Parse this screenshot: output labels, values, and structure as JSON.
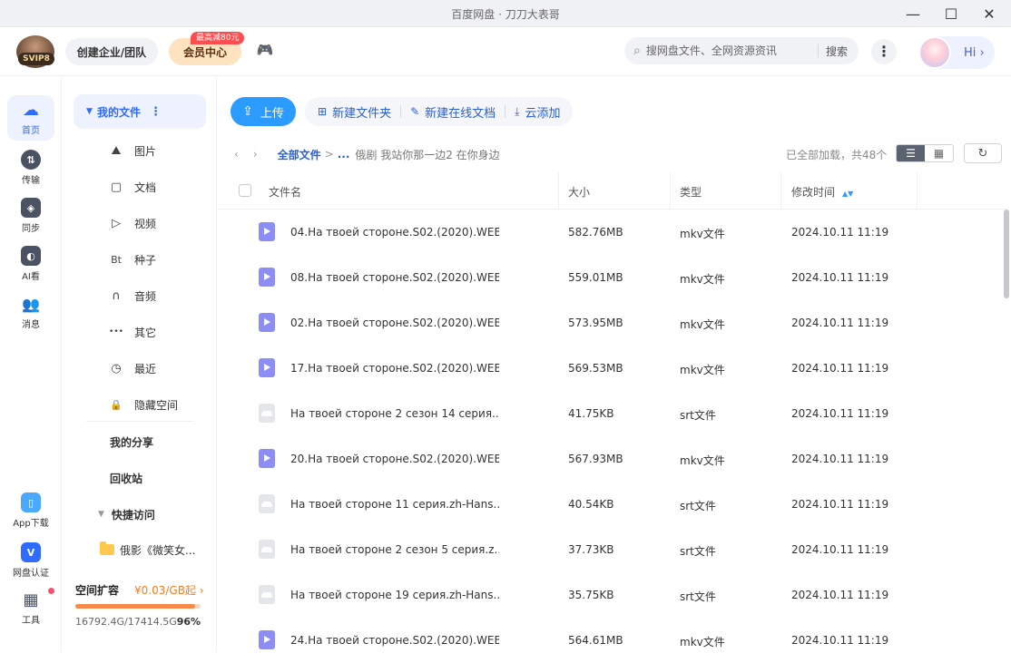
{
  "window": {
    "title": "百度网盘 · 刀刀大表哥"
  },
  "header": {
    "svip_badge": "SVIP8",
    "enterprise_label": "创建企业/团队",
    "vip_label": "会员中心",
    "promo_label": "最高减80元",
    "search_placeholder": "搜网盘文件、全网资源资讯",
    "search_button": "搜索",
    "hi_label": "Hi"
  },
  "rail": [
    {
      "label": "首页",
      "icon": "cloud-icon"
    },
    {
      "label": "传输",
      "icon": "transfer-icon"
    },
    {
      "label": "同步",
      "icon": "sync-icon"
    },
    {
      "label": "AI看",
      "icon": "ai-watch-icon"
    },
    {
      "label": "消息",
      "icon": "message-icon"
    },
    {
      "label": "App下载",
      "icon": "phone-icon"
    },
    {
      "label": "网盘认证",
      "icon": "verify-icon"
    },
    {
      "label": "工具",
      "icon": "tools-icon"
    }
  ],
  "nav": {
    "my_files": "我的文件",
    "sub_items": [
      {
        "label": "图片",
        "glyph": "⛰"
      },
      {
        "label": "文档",
        "glyph": "▢"
      },
      {
        "label": "视频",
        "glyph": "▷"
      },
      {
        "label": "种子",
        "glyph": "Bt"
      },
      {
        "label": "音频",
        "glyph": "∩"
      },
      {
        "label": "其它",
        "glyph": "•••"
      },
      {
        "label": "最近",
        "glyph": "◷"
      },
      {
        "label": "隐藏空间",
        "glyph": "🔒"
      }
    ],
    "my_share": "我的分享",
    "recycle": "回收站",
    "quick_access": "快捷访问",
    "quick_folder": "俄影《微笑女..."
  },
  "storage": {
    "title": "空间扩容",
    "price": "¥0.03/GB起",
    "usage": "16792.4G/17414.5G",
    "percent": "96%",
    "fill_fraction": 0.96
  },
  "toolbar": {
    "upload": "上传",
    "new_folder": "新建文件夹",
    "new_doc": "新建在线文档",
    "cloud_add": "云添加"
  },
  "breadcrumb": {
    "root": "全部文件",
    "sep": ">",
    "ellipsis": "...",
    "current": "俄剧 我站你那一边2 在你身边"
  },
  "list_meta": {
    "loaded": "已全部加载，共48个"
  },
  "table": {
    "headers": {
      "name": "文件名",
      "size": "大小",
      "type": "类型",
      "time": "修改时间"
    },
    "rows": [
      {
        "kind": "mkv",
        "name": "04.На твоей стороне.S02.(2020).WEB...",
        "size": "582.76MB",
        "type": "mkv文件",
        "time": "2024.10.11 11:19"
      },
      {
        "kind": "mkv",
        "name": "08.На твоей стороне.S02.(2020).WEB...",
        "size": "559.01MB",
        "type": "mkv文件",
        "time": "2024.10.11 11:19"
      },
      {
        "kind": "mkv",
        "name": "02.На твоей стороне.S02.(2020).WEB...",
        "size": "573.95MB",
        "type": "mkv文件",
        "time": "2024.10.11 11:19"
      },
      {
        "kind": "mkv",
        "name": "17.На твоей стороне.S02.(2020).WEB...",
        "size": "569.53MB",
        "type": "mkv文件",
        "time": "2024.10.11 11:19"
      },
      {
        "kind": "srt",
        "name": "На твоей стороне 2 сезон 14 серия....",
        "size": "41.75KB",
        "type": "srt文件",
        "time": "2024.10.11 11:19"
      },
      {
        "kind": "mkv",
        "name": "20.На твоей стороне.S02.(2020).WEB...",
        "size": "567.93MB",
        "type": "mkv文件",
        "time": "2024.10.11 11:19"
      },
      {
        "kind": "srt",
        "name": "На твоей стороне 11 серия.zh-Hans....",
        "size": "40.54KB",
        "type": "srt文件",
        "time": "2024.10.11 11:19"
      },
      {
        "kind": "srt",
        "name": "На твоей стороне 2 сезон 5 серия.z...",
        "size": "37.73KB",
        "type": "srt文件",
        "time": "2024.10.11 11:19"
      },
      {
        "kind": "srt",
        "name": "На твоей стороне 19 серия.zh-Hans....",
        "size": "35.75KB",
        "type": "srt文件",
        "time": "2024.10.11 11:19"
      },
      {
        "kind": "mkv",
        "name": "24.На твоей стороне.S02.(2020).WEB...",
        "size": "564.61MB",
        "type": "mkv文件",
        "time": "2024.10.11 11:19"
      }
    ]
  },
  "colors": {
    "accent": "#2b9bff",
    "link": "#2b5fd1",
    "mkv_icon": "#8c8df5",
    "srt_icon": "#e4e6ea",
    "storage_fill": "#f58a4a"
  }
}
